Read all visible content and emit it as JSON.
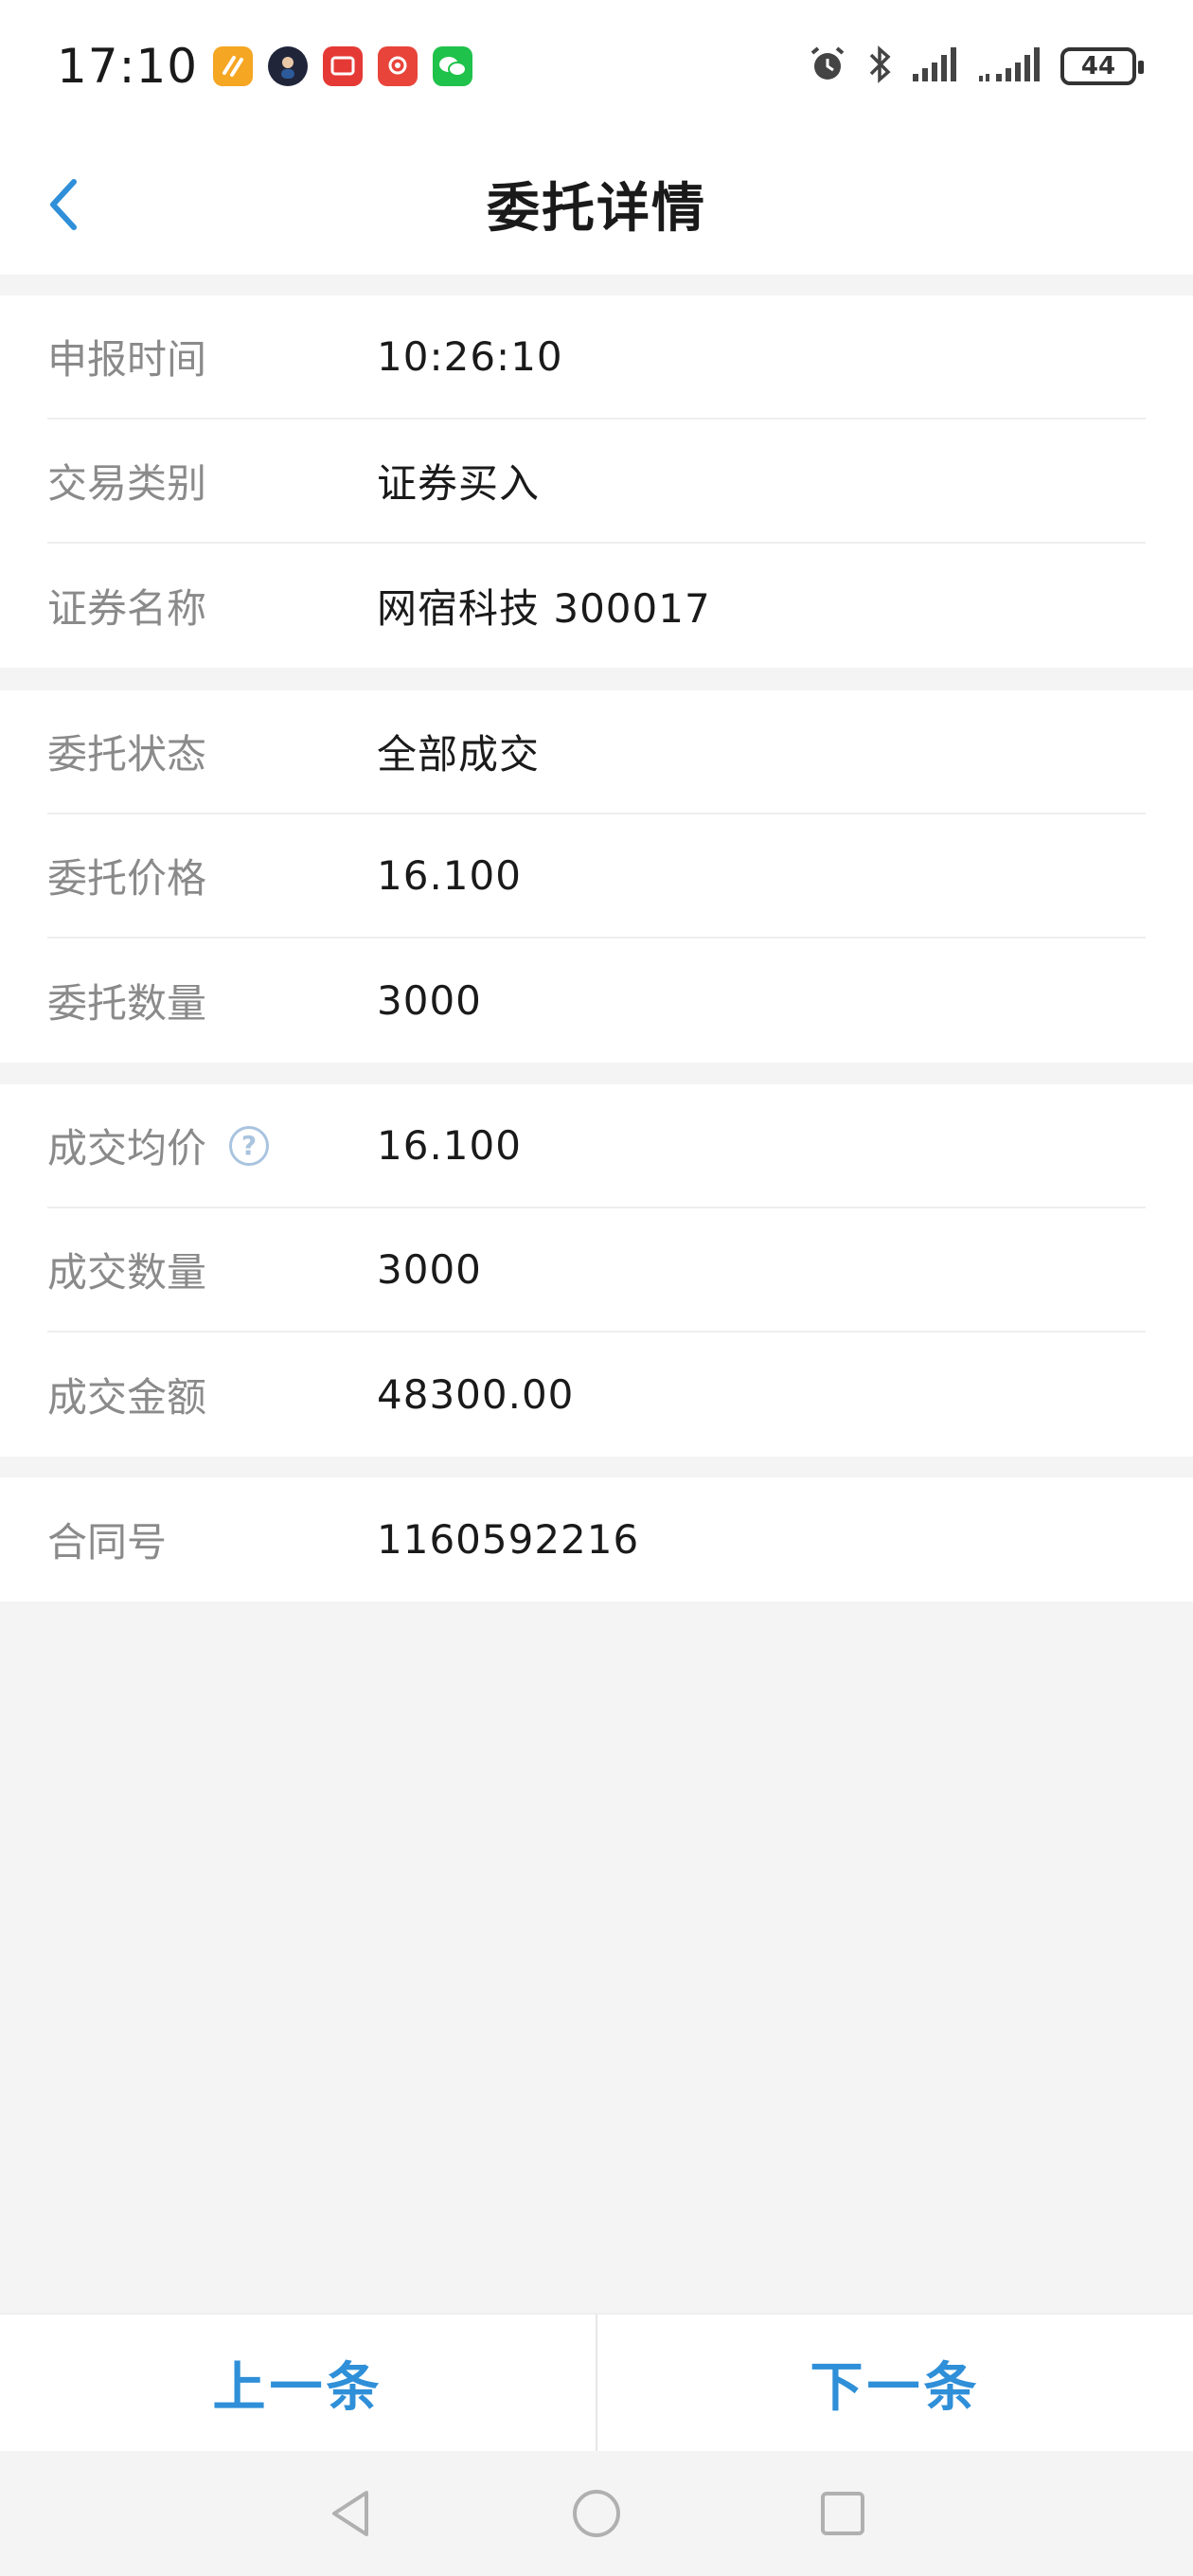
{
  "status_bar": {
    "time": "17:10",
    "battery": "44",
    "app_icons": [
      "orange-app-icon",
      "avatar-app-icon",
      "red-reader-icon",
      "red-app-icon",
      "wechat-icon"
    ],
    "system_icons": [
      "alarm-icon",
      "bluetooth-icon",
      "signal-icon",
      "signal-icon"
    ]
  },
  "header": {
    "title": "委托详情",
    "back_icon": "chevron-left-icon"
  },
  "sections": [
    {
      "rows": [
        {
          "label": "申报时间",
          "value": "10:26:10"
        },
        {
          "label": "交易类别",
          "value": "证券买入"
        },
        {
          "label": "证券名称",
          "value": "网宿科技 300017"
        }
      ]
    },
    {
      "rows": [
        {
          "label": "委托状态",
          "value": "全部成交"
        },
        {
          "label": "委托价格",
          "value": "16.100"
        },
        {
          "label": "委托数量",
          "value": "3000"
        }
      ]
    },
    {
      "rows": [
        {
          "label": "成交均价",
          "value": "16.100",
          "help_icon": "?"
        },
        {
          "label": "成交数量",
          "value": "3000"
        },
        {
          "label": "成交金额",
          "value": "48300.00"
        }
      ]
    },
    {
      "rows": [
        {
          "label": "合同号",
          "value": "1160592216"
        }
      ]
    }
  ],
  "footer": {
    "prev_label": "上一条",
    "next_label": "下一条"
  },
  "colors": {
    "accent": "#2f8fd8",
    "label": "#8a8a8a",
    "value": "#1a1a1a",
    "background": "#f4f4f4"
  }
}
